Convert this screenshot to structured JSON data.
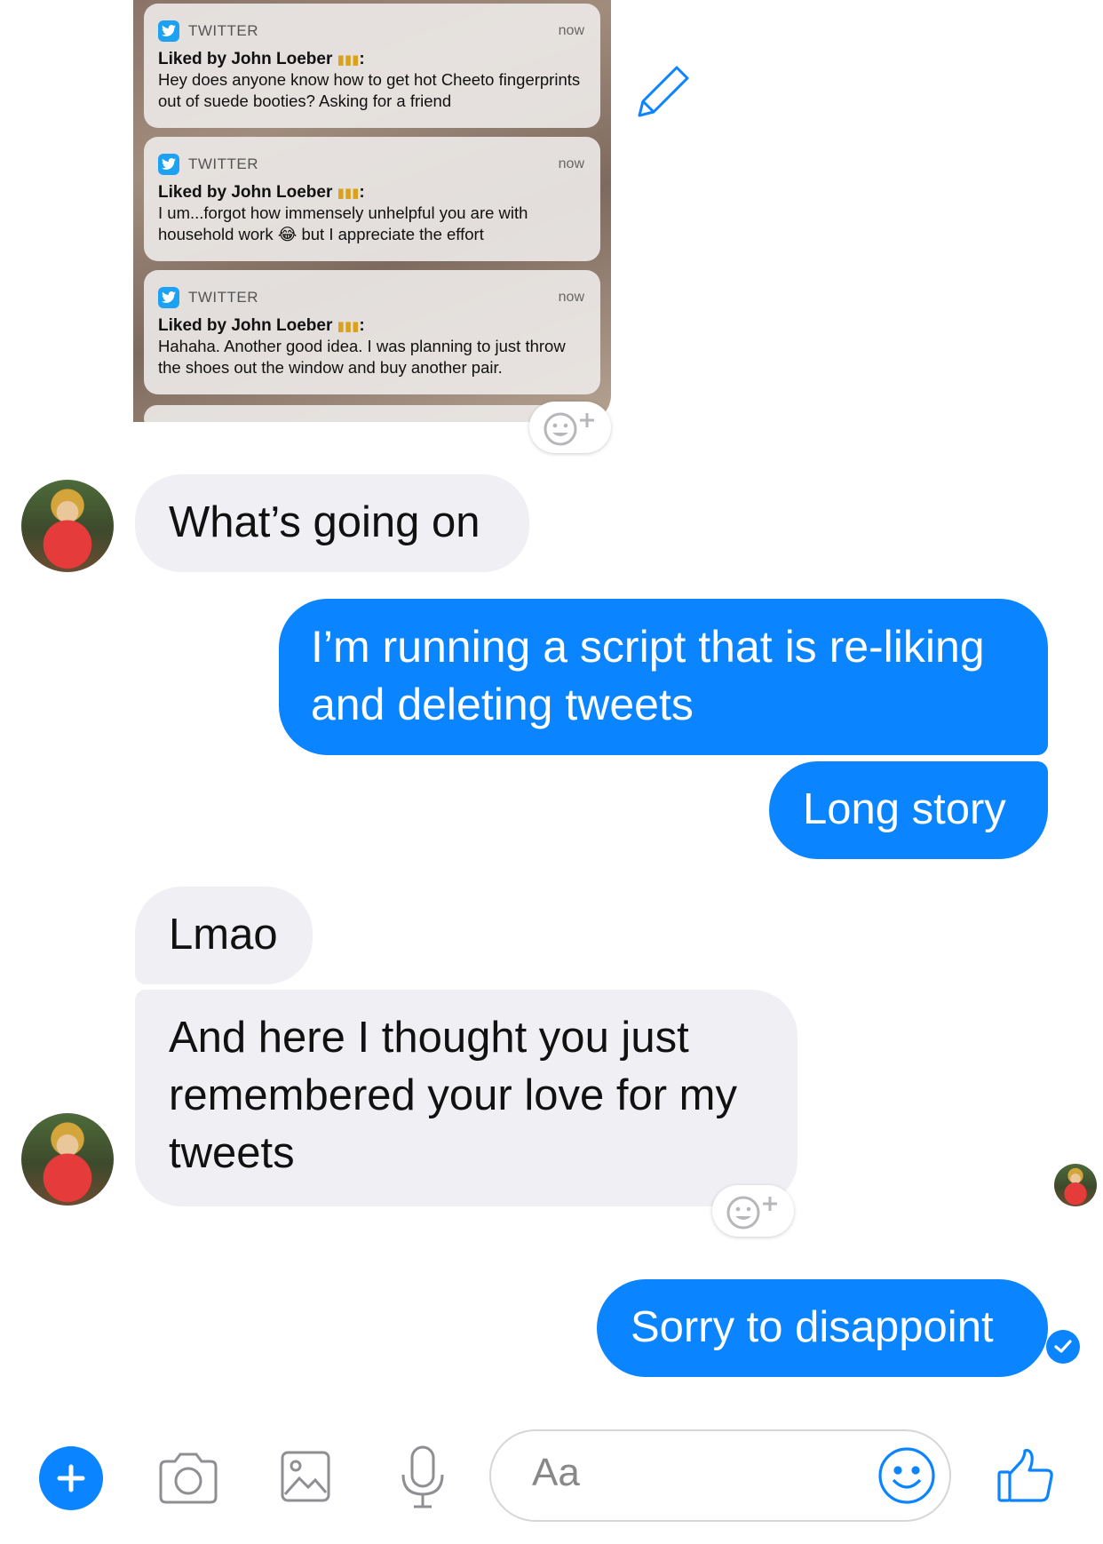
{
  "screenshot_notifications": [
    {
      "app": "TWITTER",
      "time": "now",
      "title": "Liked by John Loeber",
      "body": "Hey does anyone know how to get hot Cheeto fingerprints out of suede booties? Asking for a friend"
    },
    {
      "app": "TWITTER",
      "time": "now",
      "title": "Liked by John Loeber",
      "body": "I um...forgot how immensely unhelpful you are with household work 😂 but I appreciate the effort"
    },
    {
      "app": "TWITTER",
      "time": "now",
      "title": "Liked by John Loeber",
      "body": "Hahaha. Another good idea. I was planning to just throw the shoes out the window and buy another pair."
    }
  ],
  "messages": [
    {
      "from": "them",
      "text": "What’s going on"
    },
    {
      "from": "me",
      "text": "I’m running a script that is re-liking and deleting tweets"
    },
    {
      "from": "me",
      "text": "Long story"
    },
    {
      "from": "them",
      "text": "Lmao"
    },
    {
      "from": "them",
      "text": "And here I thought you just remembered your love for my tweets"
    },
    {
      "from": "me",
      "text": "Sorry to disappoint"
    }
  ],
  "composer": {
    "placeholder": "Aa"
  },
  "icons": {
    "edit": "pencil-icon",
    "reaction": "add-reaction-icon",
    "plus": "plus-icon",
    "camera": "camera-icon",
    "gallery": "image-icon",
    "mic": "microphone-icon",
    "emoji": "emoji-icon",
    "like": "thumbs-up-icon",
    "seen": "check-icon"
  },
  "colors": {
    "accent": "#0a84ff",
    "incoming_bubble": "#f0eff4"
  }
}
